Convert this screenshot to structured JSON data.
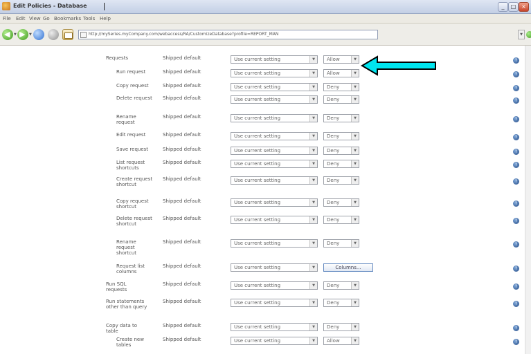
{
  "window": {
    "title": "Edit Policies - Database",
    "buttons": {
      "minimize": "_",
      "maximize": "□",
      "close": "×"
    }
  },
  "menu": [
    "File",
    "Edit",
    "View",
    "Go",
    "Bookmarks",
    "Tools",
    "Help"
  ],
  "toolbar": {
    "back": "◀",
    "forward": "▶",
    "dropdown": "▼",
    "address": "http://mySeries.myCompany.com/webaccess/RA/CustomizeDatabase?profile=REPORT_MAN",
    "address_dropdown": "▼"
  },
  "rows": [
    {
      "name": "Requests",
      "value": "Shipped default",
      "setting": "Use current setting",
      "action": "Allow"
    },
    {
      "name": "Run request",
      "value": "Shipped default",
      "setting": "Use current setting",
      "action": "Allow"
    },
    {
      "name": "Copy request",
      "value": "Shipped default",
      "setting": "Use current setting",
      "action": "Deny"
    },
    {
      "name": "Delete request",
      "value": "Shipped default",
      "setting": "Use current setting",
      "action": "Deny"
    },
    {
      "name": "Rename request",
      "value": "Shipped default",
      "setting": "Use current setting",
      "action": "Deny"
    },
    {
      "name": "Edit request",
      "value": "Shipped default",
      "setting": "Use current setting",
      "action": "Deny"
    },
    {
      "name": "Save request",
      "value": "Shipped default",
      "setting": "Use current setting",
      "action": "Deny"
    },
    {
      "name": "List request shortcuts",
      "value": "Shipped default",
      "setting": "Use current setting",
      "action": "Deny"
    },
    {
      "name": "Create request shortcut",
      "value": "Shipped default",
      "setting": "Use current setting",
      "action": "Deny"
    },
    {
      "name": "Copy request shortcut",
      "value": "Shipped default",
      "setting": "Use current setting",
      "action": "Deny"
    },
    {
      "name": "Delete request shortcut",
      "value": "Shipped default",
      "setting": "Use current setting",
      "action": "Deny"
    },
    {
      "name": "Rename request shortcut",
      "value": "Shipped default",
      "setting": "Use current setting",
      "action": "Deny"
    },
    {
      "name": "Request list columns",
      "value": "Shipped default",
      "setting": "Use current setting",
      "action": "Columns..."
    },
    {
      "name": "Run SQL requests",
      "value": "Shipped default",
      "setting": "Use current setting",
      "action": "Deny"
    },
    {
      "name": "Run statements other than query",
      "value": "Shipped default",
      "setting": "Use current setting",
      "action": "Deny"
    },
    {
      "name": "Copy data to table",
      "value": "Shipped default",
      "setting": "Use current setting",
      "action": "Deny"
    },
    {
      "name": "Create new tables",
      "value": "Shipped default",
      "setting": "Use current setting",
      "action": "Allow"
    }
  ],
  "icons": {
    "help": "?",
    "dropdown": "▼"
  },
  "colors": {
    "arrow": "#00e5ef",
    "title": "#333333",
    "help": "#284e86"
  }
}
